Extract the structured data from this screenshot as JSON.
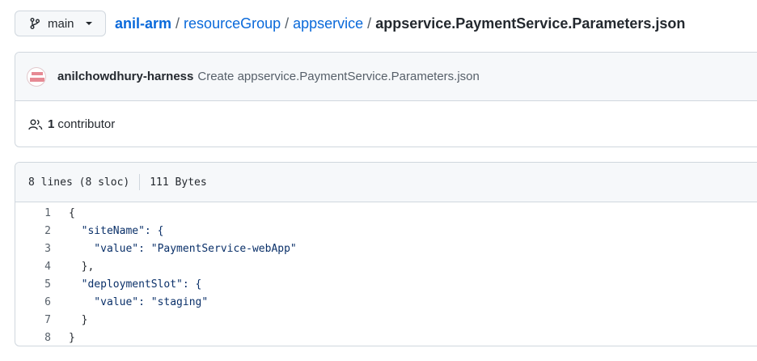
{
  "branch": {
    "name": "main"
  },
  "breadcrumb": {
    "repo": "anil-arm",
    "folder1": "resourceGroup",
    "folder2": "appservice",
    "separator": "/",
    "file": "appservice.PaymentService.Parameters.json"
  },
  "commit": {
    "author": "anilchowdhury-harness",
    "message": "Create appservice.PaymentService.Parameters.json"
  },
  "contributors": {
    "count": "1",
    "label": "contributor"
  },
  "file_info": {
    "lines": "8 lines (8 sloc)",
    "size": "111 Bytes"
  },
  "code": {
    "lines": [
      {
        "n": "1",
        "text": "{"
      },
      {
        "n": "2",
        "text": "  \"siteName\": {"
      },
      {
        "n": "3",
        "text": "    \"value\": \"PaymentService-webApp\""
      },
      {
        "n": "4",
        "text": "  },"
      },
      {
        "n": "5",
        "text": "  \"deploymentSlot\": {"
      },
      {
        "n": "6",
        "text": "    \"value\": \"staging\""
      },
      {
        "n": "7",
        "text": "  }"
      },
      {
        "n": "8",
        "text": "}"
      }
    ]
  }
}
